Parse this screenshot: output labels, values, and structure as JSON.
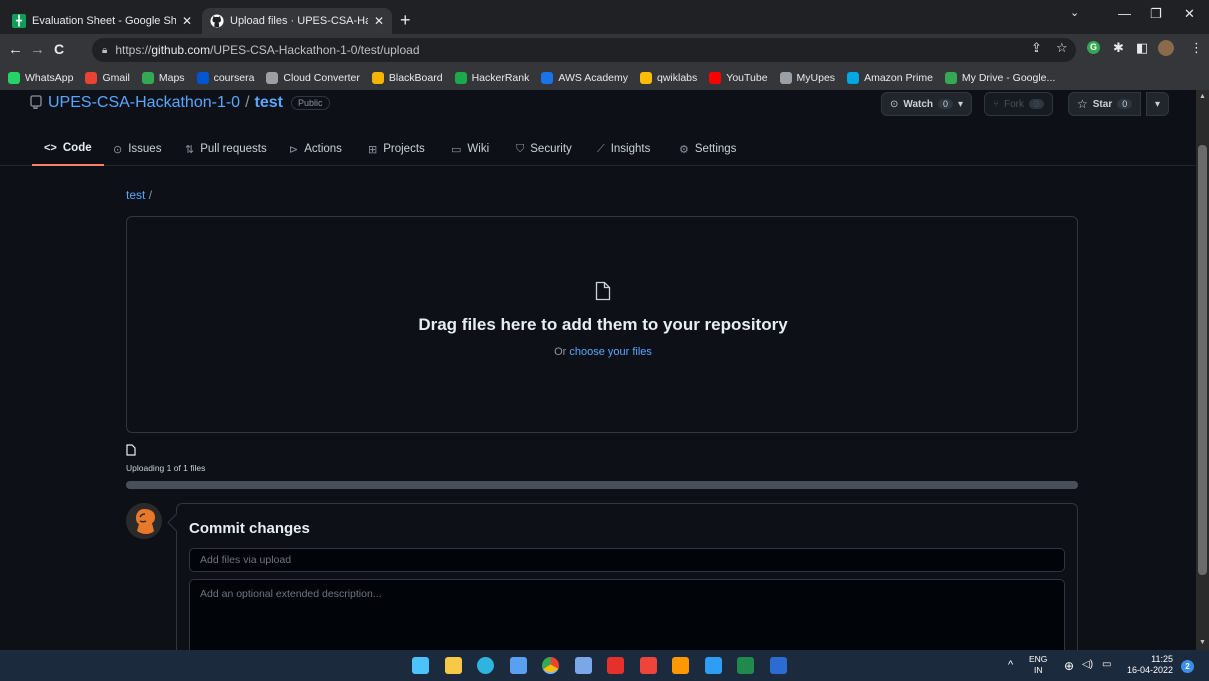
{
  "browser": {
    "tabs": [
      {
        "title": "Evaluation Sheet - Google Sheets",
        "close": "✕",
        "favicon": "sheets-icon",
        "active": false
      },
      {
        "title": "Upload files · UPES-CSA-Hackath",
        "close": "✕",
        "favicon": "github-icon",
        "active": true
      }
    ],
    "new_tab": "+",
    "url_prefix": "https://",
    "url_host": "github.com",
    "url_path": "/UPES-CSA-Hackathon-1-0/test/upload",
    "bookmarks": [
      {
        "label": "WhatsApp",
        "color": "#25d366"
      },
      {
        "label": "Gmail",
        "color": "#ea4335"
      },
      {
        "label": "Maps",
        "color": "#34a853"
      },
      {
        "label": "coursera",
        "color": "#0056d2"
      },
      {
        "label": "Cloud Converter",
        "color": "#9aa0a6"
      },
      {
        "label": "BlackBoard",
        "color": "#f4b400"
      },
      {
        "label": "HackerRank",
        "color": "#1ba94c"
      },
      {
        "label": "AWS Academy",
        "color": "#1a73e8"
      },
      {
        "label": "qwiklabs",
        "color": "#fbbc04"
      },
      {
        "label": "YouTube",
        "color": "#ff0000"
      },
      {
        "label": "MyUpes",
        "color": "#9aa0a6"
      },
      {
        "label": "Amazon Prime",
        "color": "#00a8e1"
      },
      {
        "label": "My Drive - Google...",
        "color": "#34a853"
      }
    ]
  },
  "repo": {
    "owner": "UPES-CSA-Hackathon-1-0",
    "name": "test",
    "visibility": "Public",
    "watch_label": "Watch",
    "watch_count": "0",
    "fork_label": "Fork",
    "fork_count": "0",
    "star_label": "Star",
    "star_count": "0"
  },
  "nav": {
    "items": [
      {
        "label": "Code",
        "icon": "code-icon"
      },
      {
        "label": "Issues",
        "icon": "issue-icon"
      },
      {
        "label": "Pull requests",
        "icon": "pull-request-icon"
      },
      {
        "label": "Actions",
        "icon": "play-icon"
      },
      {
        "label": "Projects",
        "icon": "table-icon"
      },
      {
        "label": "Wiki",
        "icon": "book-icon"
      },
      {
        "label": "Security",
        "icon": "shield-icon"
      },
      {
        "label": "Insights",
        "icon": "graph-icon"
      },
      {
        "label": "Settings",
        "icon": "gear-icon"
      }
    ],
    "selected": "Code"
  },
  "upload": {
    "breadcrumb_repo": "test",
    "breadcrumb_sep": "/",
    "drop_title": "Drag files here to add them to your repository",
    "drop_or": "Or",
    "choose_link": "choose your files",
    "status": "Uploading 1 of 1 files",
    "progress_fraction": 1.0
  },
  "commit": {
    "title": "Commit changes",
    "summary_placeholder": "Add files via upload",
    "description_placeholder": "Add an optional extended description..."
  },
  "taskbar": {
    "lang_top": "ENG",
    "lang_bottom": "IN",
    "time": "11:25",
    "date": "16-04-2022",
    "notifications": "2",
    "apps": [
      {
        "name": "start-icon",
        "color": "#4cc2ff"
      },
      {
        "name": "file-explorer-icon",
        "color": "#f9c846"
      },
      {
        "name": "edge-icon",
        "color": "#2fb4e0"
      },
      {
        "name": "store-icon",
        "color": "#5aa0f0"
      },
      {
        "name": "chrome-icon",
        "color": "#e94235"
      },
      {
        "name": "app-icon",
        "color": "#7aa7e8"
      },
      {
        "name": "acrobat-icon",
        "color": "#e6302b"
      },
      {
        "name": "anydesk-icon",
        "color": "#ef443b"
      },
      {
        "name": "sublime-icon",
        "color": "#ff9800"
      },
      {
        "name": "vscode-icon",
        "color": "#2e9ef4"
      },
      {
        "name": "excel-icon",
        "color": "#1f8a4c"
      },
      {
        "name": "word-icon",
        "color": "#2b6cd3"
      }
    ]
  }
}
